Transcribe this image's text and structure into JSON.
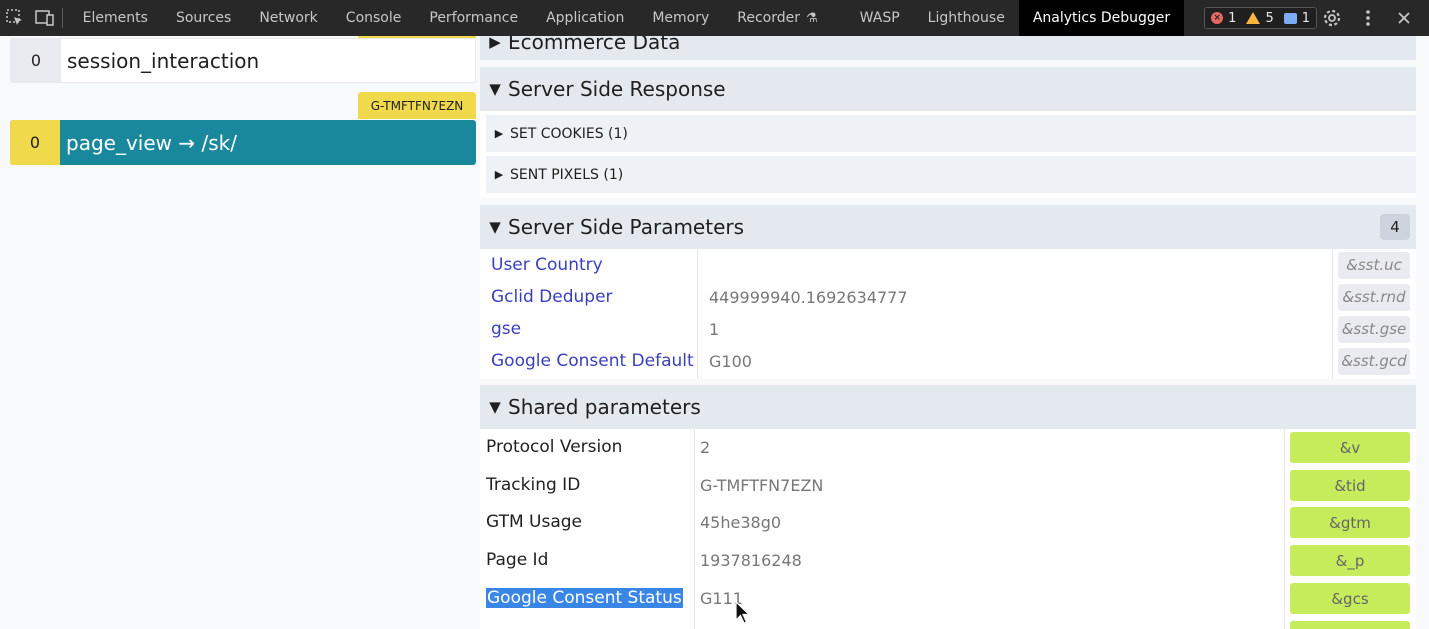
{
  "devtools": {
    "tabs": [
      "Elements",
      "Sources",
      "Network",
      "Console",
      "Performance",
      "Application",
      "Memory",
      "Recorder",
      "WASP",
      "Lighthouse",
      "Analytics Debugger"
    ],
    "active_tab": "Analytics Debugger",
    "counters": {
      "errors": "1",
      "warnings": "5",
      "messages": "1"
    }
  },
  "events": {
    "session_interaction": {
      "count": "0",
      "name": "session_interaction"
    },
    "property_tag": "G-TMFTFN7EZN",
    "page_view": {
      "count": "0",
      "name": "page_view → /sk/"
    }
  },
  "sections": {
    "ecommerce": "Ecommerce Data",
    "server_response": {
      "title": "Server Side Response",
      "set_cookies": "SET COOKIES (1)",
      "sent_pixels": "SENT PIXELS (1)"
    },
    "server_params": {
      "title": "Server Side Parameters",
      "count": "4",
      "rows": [
        {
          "name": "User Country",
          "value": "",
          "key": "&sst.uc"
        },
        {
          "name": "Gclid Deduper",
          "value": "449999940.1692634777",
          "key": "&sst.rnd"
        },
        {
          "name": "gse",
          "value": "1",
          "key": "&sst.gse"
        },
        {
          "name": "Google Consent Default",
          "value": "G100",
          "key": "&sst.gcd"
        }
      ]
    },
    "shared": {
      "title": "Shared parameters",
      "rows": [
        {
          "name": "Protocol Version",
          "value": "2",
          "key": "&v"
        },
        {
          "name": "Tracking ID",
          "value": "G-TMFTFN7EZN",
          "key": "&tid"
        },
        {
          "name": "GTM Usage",
          "value": "45he38g0",
          "key": "&gtm"
        },
        {
          "name": "Page Id",
          "value": "1937816248",
          "key": "&_p"
        },
        {
          "name": "Google Consent Status",
          "value": "G111",
          "key": "&gcs"
        }
      ]
    }
  }
}
